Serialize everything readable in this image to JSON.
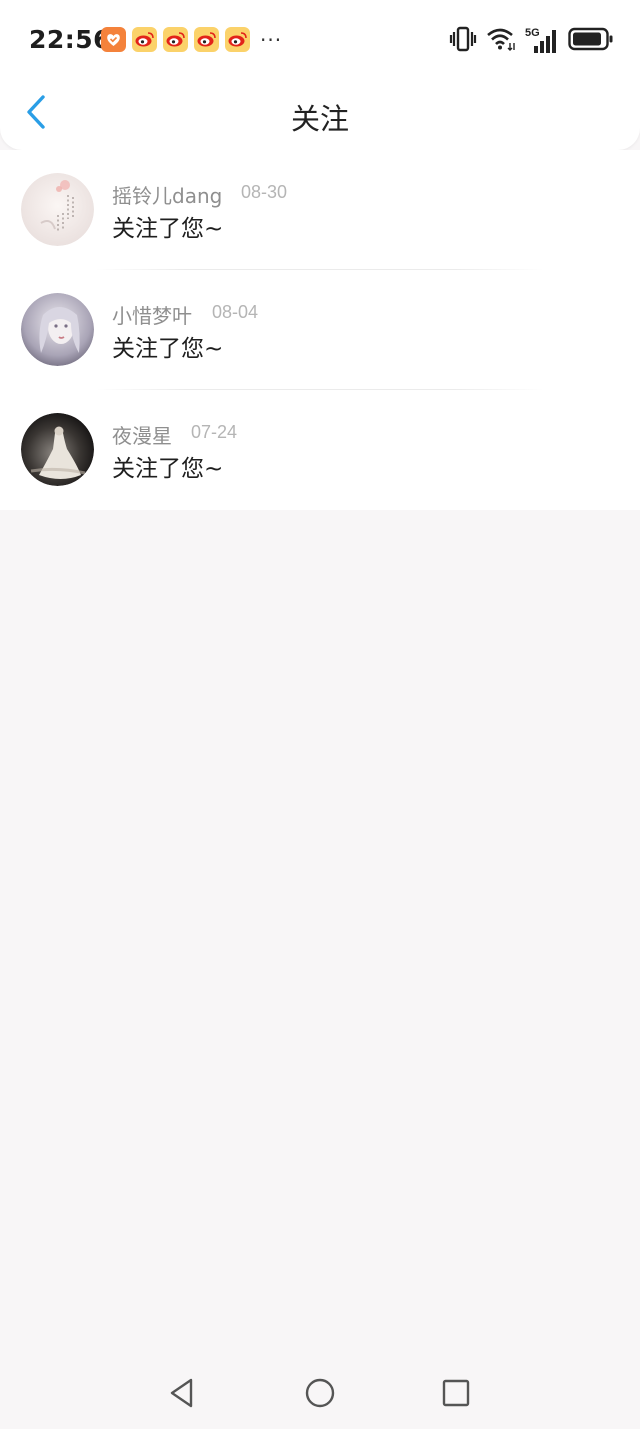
{
  "status_bar": {
    "time": "22:56",
    "notification_icons": [
      "shopping-app-icon",
      "weibo-icon",
      "weibo-icon",
      "weibo-icon",
      "weibo-icon"
    ],
    "more_indicator": "···",
    "system_icons": [
      "vibrate-icon",
      "wifi-icon",
      "signal-5g-icon",
      "battery-icon"
    ],
    "network_label": "5G"
  },
  "header": {
    "title": "关注",
    "back_icon": "chevron-left-icon"
  },
  "follow_list": [
    {
      "name": "摇铃儿dang",
      "date": "08-30",
      "message": "关注了您~"
    },
    {
      "name": "小惜梦叶",
      "date": "08-04",
      "message": "关注了您~"
    },
    {
      "name": "夜漫星",
      "date": "07-24",
      "message": "关注了您~"
    }
  ],
  "nav_bar": {
    "buttons": [
      "back-triangle-icon",
      "home-circle-icon",
      "recents-square-icon"
    ]
  },
  "colors": {
    "accent": "#2a9ee6",
    "background": "#f8f6f7",
    "card": "#ffffff",
    "name_text": "#8f8f8f",
    "date_text": "#b5b5b5",
    "message_text": "#1f1f1f"
  }
}
